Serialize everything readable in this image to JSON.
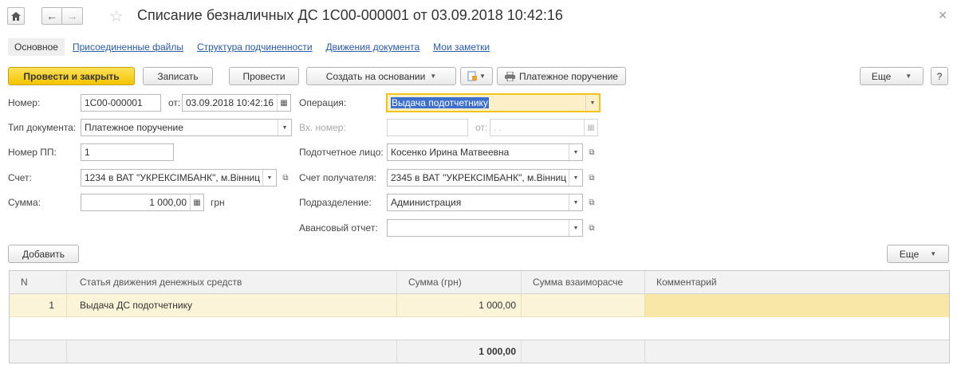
{
  "window": {
    "title": "Списание безналичных ДС 1С00-000001 от 03.09.2018 10:42:16",
    "close_icon": "✕"
  },
  "tabs": [
    {
      "label": "Основное",
      "active": true
    },
    {
      "label": "Присоединенные файлы"
    },
    {
      "label": "Структура подчиненности"
    },
    {
      "label": "Движения документа"
    },
    {
      "label": "Мои заметки"
    }
  ],
  "toolbar": {
    "post_close": "Провести и закрыть",
    "write": "Записать",
    "post": "Провести",
    "create_based": "Создать на основании",
    "payment_order": "Платежное поручение",
    "more": "Еще",
    "help": "?"
  },
  "form": {
    "number_label": "Номер:",
    "number_value": "1С00-000001",
    "from_label": "от:",
    "date_value": "03.09.2018 10:42:16",
    "operation_label": "Операция:",
    "operation_value": "Выдача подотчетнику",
    "doc_type_label": "Тип документа:",
    "doc_type_value": "Платежное поручение",
    "in_number_label": "Вх. номер:",
    "in_number_value": "",
    "in_from_label": "от:",
    "in_date_placeholder": " .  .",
    "pp_number_label": "Номер ПП:",
    "pp_number_value": "1",
    "accountable_label": "Подотчетное лицо:",
    "accountable_value": "Косенко Ирина Матвеевна",
    "account_label": "Счет:",
    "account_value": "1234 в ВАТ \"УКРЕКСІМБАНК\", м.Вінниц",
    "recipient_account_label": "Счет получателя:",
    "recipient_account_value": "2345 в ВАТ \"УКРЕКСІМБАНК\", м.Вінниц",
    "amount_label": "Сумма:",
    "amount_value": "1 000,00",
    "currency": "грн",
    "department_label": "Подразделение:",
    "department_value": "Администрация",
    "advance_report_label": "Авансовый отчет:",
    "advance_report_value": ""
  },
  "table_toolbar": {
    "add": "Добавить",
    "more": "Еще"
  },
  "table": {
    "columns": [
      "N",
      "Статья движения денежных средств",
      "Сумма (грн)",
      "Сумма взаиморасче",
      "Комментарий"
    ],
    "rows": [
      {
        "n": "1",
        "item": "Выдача ДС подотчетнику",
        "amount": "1 000,00",
        "settlement": "",
        "comment": ""
      }
    ],
    "footer_total": "1 000,00"
  }
}
